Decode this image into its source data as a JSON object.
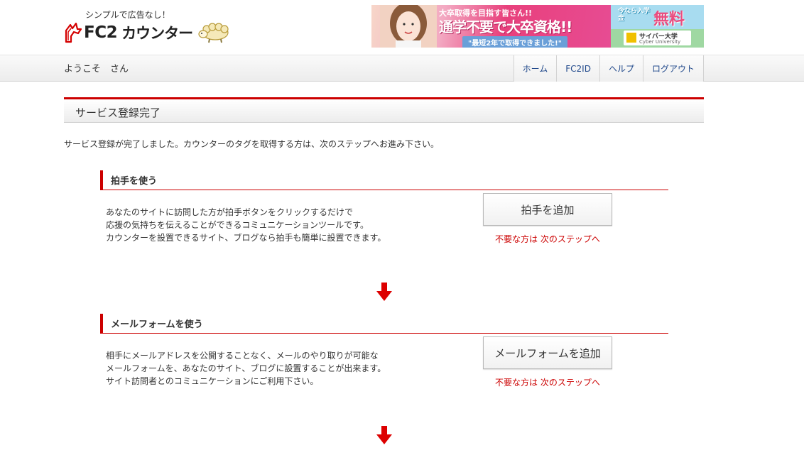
{
  "header": {
    "tagline": "シンプルで広告なし！",
    "logo_fc2": "FC2",
    "logo_counter": "カウンター"
  },
  "banner": {
    "line1": "大卒取得を目指す皆さん!!",
    "line2": "通学不要で大卒資格!!",
    "line3": "\"最短2年で取得できました!\"",
    "side_line1": "今なら入学金",
    "side_line2": "無料",
    "side_badge_name": "サイバー大学",
    "side_badge_en": "Cyber University"
  },
  "nav": {
    "welcome": "ようこそ　さん",
    "links": [
      "ホーム",
      "FC2ID",
      "ヘルプ",
      "ログアウト"
    ]
  },
  "main": {
    "title": "サービス登録完了",
    "intro": "サービス登録が完了しました。カウンターのタグを取得する方は、次のステップへお進み下さい。",
    "sections": [
      {
        "heading": "拍手を使う",
        "desc_lines": [
          "あなたのサイトに訪問した方が拍手ボタンをクリックするだけで",
          "応援の気持ちを伝えることができるコミュニケーションツールです。",
          "カウンターを設置できるサイト、ブログなら拍手も簡単に設置できます。"
        ],
        "button": "拍手を追加",
        "skip": "不要な方は 次のステップへ"
      },
      {
        "heading": "メールフォームを使う",
        "desc_lines": [
          "相手にメールアドレスを公開することなく、メールのやり取りが可能な",
          "メールフォームを、あなたのサイト、ブログに設置することが出来ます。",
          "サイト訪問者とのコミュニケーションにご利用下さい。"
        ],
        "button": "メールフォームを追加",
        "skip": "不要な方は 次のステップへ"
      }
    ]
  },
  "colors": {
    "accent_red": "#cc0000",
    "nav_link": "#224a8c"
  }
}
